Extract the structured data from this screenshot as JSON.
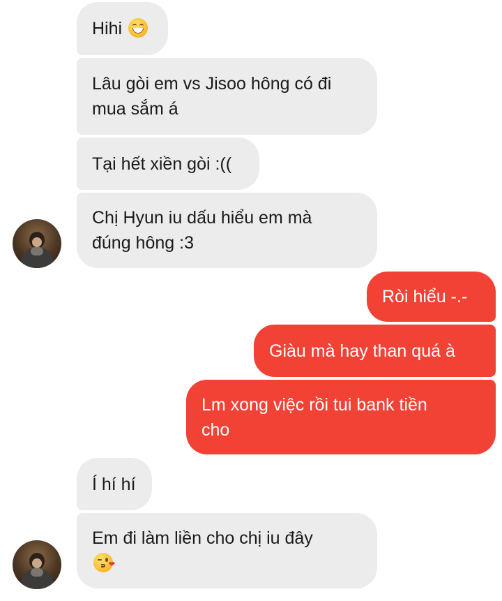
{
  "conversation": {
    "messages": [
      {
        "side": "in",
        "text": "Hihi",
        "emoji": "grinning-face-icon"
      },
      {
        "side": "in",
        "lines": [
          "Lâu gòi em vs Jisoo hông có đi",
          "mua sắm á"
        ]
      },
      {
        "side": "in",
        "text": "Tại hết xiền gòi :(("
      },
      {
        "side": "in",
        "lines": [
          "Chị Hyun iu dấu hiểu em mà",
          "đúng hông :3"
        ]
      },
      {
        "side": "out",
        "text": "Ròi hiểu -.-"
      },
      {
        "side": "out",
        "text": "Giàu mà hay than quá à"
      },
      {
        "side": "out",
        "lines": [
          "Lm xong việc rồi tui bank tiền",
          "cho"
        ]
      },
      {
        "side": "in",
        "text": "Í hí hí"
      },
      {
        "side": "in",
        "lines": [
          "Em đi làm liền cho chị iu đây"
        ],
        "emoji": "face-blowing-kiss-icon"
      }
    ]
  },
  "colors": {
    "incoming_bubble": "#ececec",
    "outgoing_bubble": "#f24236",
    "incoming_text": "#1a1a1a",
    "outgoing_text": "#ffffff",
    "background": "#ffffff"
  }
}
